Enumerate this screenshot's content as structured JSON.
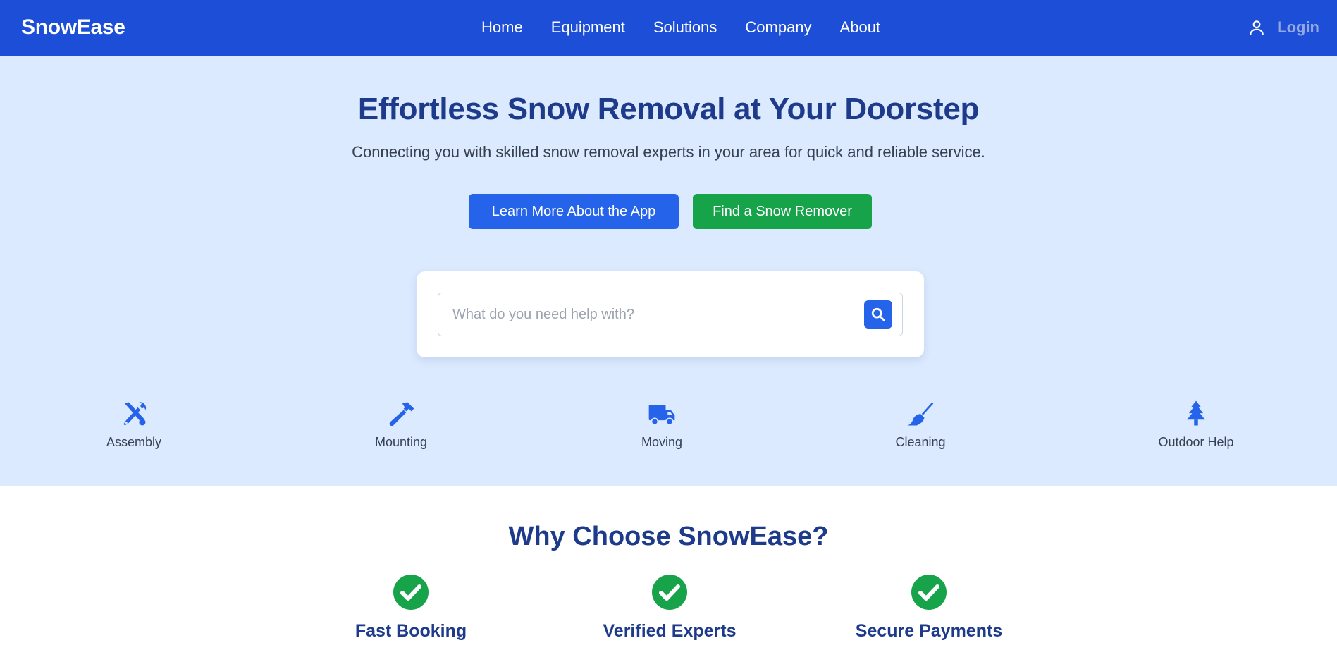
{
  "header": {
    "brand": "SnowEase",
    "nav": [
      "Home",
      "Equipment",
      "Solutions",
      "Company",
      "About"
    ],
    "login_label": "Login",
    "login_icon": "user-icon",
    "background": "#1d4ed8"
  },
  "hero": {
    "title": "Effortless Snow Removal at Your Doorstep",
    "subtitle": "Connecting you with skilled snow removal experts in your area for quick and reliable service.",
    "learn_button": "Learn More About the App",
    "find_button": "Find a Snow Remover",
    "background": "#dbeafe"
  },
  "search": {
    "placeholder": "What do you need help with?",
    "value": "",
    "button_icon": "search-icon"
  },
  "categories": [
    {
      "label": "Assembly",
      "icon": "tools-icon"
    },
    {
      "label": "Mounting",
      "icon": "hammer-icon"
    },
    {
      "label": "Moving",
      "icon": "truck-icon"
    },
    {
      "label": "Cleaning",
      "icon": "broom-icon"
    },
    {
      "label": "Outdoor Help",
      "icon": "tree-icon"
    }
  ],
  "why": {
    "title": "Why Choose SnowEase?",
    "features": [
      {
        "label": "Fast Booking",
        "icon": "check-circle-icon"
      },
      {
        "label": "Verified Experts",
        "icon": "check-circle-icon"
      },
      {
        "label": "Secure Payments",
        "icon": "check-circle-icon"
      }
    ]
  },
  "colors": {
    "primary": "#2563eb",
    "success": "#16a34a",
    "heading": "#1e3a8a"
  }
}
